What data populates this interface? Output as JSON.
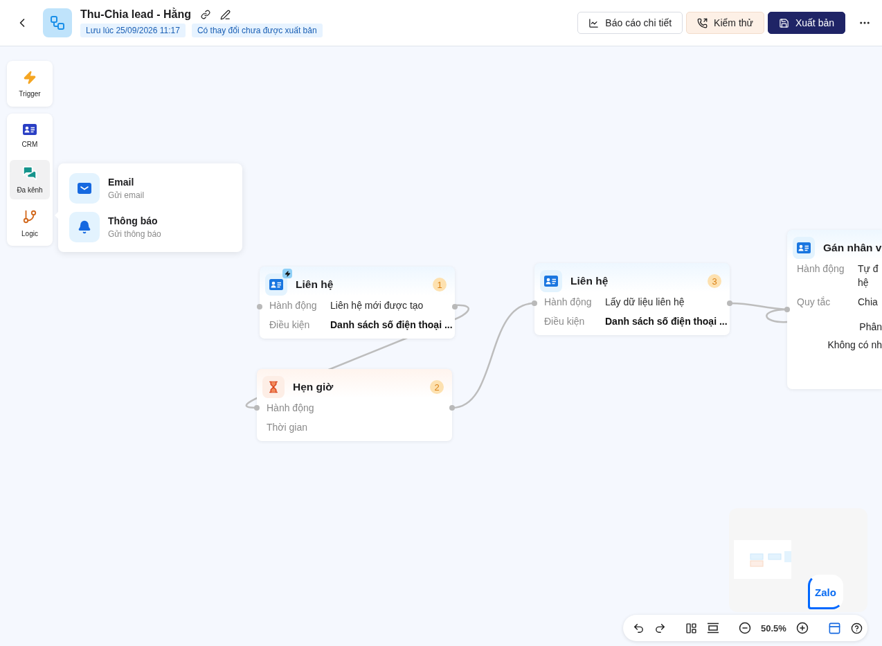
{
  "header": {
    "title": "Thu-Chia lead - Hằng",
    "tags": [
      "Lưu lúc 25/09/2026 11:17",
      "Có thay đổi chưa được xuất bản"
    ],
    "actions": [
      {
        "label": "Báo cáo chi tiết",
        "kind": "report"
      },
      {
        "label": "Kiểm thử",
        "kind": "test"
      },
      {
        "label": "Xuất bản",
        "kind": "publish"
      }
    ]
  },
  "palette": {
    "groups": [
      {
        "items": [
          {
            "label": "Trigger",
            "kind": "trigger",
            "selected": false
          }
        ]
      },
      {
        "items": [
          {
            "label": "CRM",
            "kind": "crm",
            "selected": false
          },
          {
            "label": "Đa kênh",
            "kind": "channel",
            "selected": true
          },
          {
            "label": "Logic",
            "kind": "logic",
            "selected": false
          }
        ]
      }
    ]
  },
  "popover": {
    "items": [
      {
        "title": "Email",
        "subtitle": "Gửi email",
        "kind": "mail"
      },
      {
        "title": "Thông báo",
        "subtitle": "Gửi thông báo",
        "kind": "bell"
      }
    ]
  },
  "nodes": [
    {
      "kind": "contact",
      "title": "Liên hệ",
      "number": "1",
      "trigger": true,
      "rows": [
        {
          "label": "Hành động",
          "lines": [
            "Liên hệ mới được tạo"
          ],
          "bold": false
        },
        {
          "label": "Điều kiện",
          "lines": [
            "Danh sách số điện thoại ..."
          ],
          "bold": true
        }
      ]
    },
    {
      "kind": "timer",
      "title": "Hẹn giờ",
      "number": "2",
      "trigger": false,
      "rows": [
        {
          "label": "Hành động",
          "lines": []
        },
        {
          "label": "Thời gian",
          "lines": []
        }
      ]
    },
    {
      "kind": "contact",
      "title": "Liên hệ",
      "number": "3",
      "trigger": false,
      "rows": [
        {
          "label": "Hành động",
          "lines": [
            "Lấy dữ liệu liên hệ"
          ],
          "bold": false
        },
        {
          "label": "Điều kiện",
          "lines": [
            "Danh sách số điện thoại ..."
          ],
          "bold": true
        }
      ]
    },
    {
      "kind": "assign",
      "title": "Gán nhân v",
      "trigger": false,
      "rows": [
        {
          "label": "Hành động",
          "lines": [
            "Tự đ",
            "hệ"
          ],
          "bold": false
        },
        {
          "label": "Quy tắc",
          "lines": [
            "Chia"
          ],
          "bold": false
        }
      ],
      "notes": [
        "Phân",
        "Không có nh"
      ]
    }
  ],
  "zoom_controls": {
    "zoom": "50.5%"
  },
  "chat_widget": {
    "label": "Zalo"
  }
}
